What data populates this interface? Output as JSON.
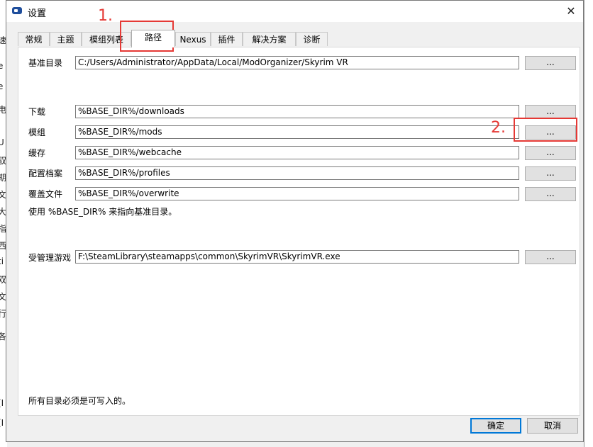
{
  "background": {
    "fragments": [
      "速",
      "e",
      "e",
      "电",
      "U",
      "驭",
      "期",
      "文",
      "大",
      "指",
      "西",
      "ti",
      "双",
      "文",
      "行",
      "各",
      "(I",
      "(I"
    ]
  },
  "window": {
    "title": "设置",
    "close_glyph": "✕"
  },
  "tabs": [
    {
      "label": "常规"
    },
    {
      "label": "主题"
    },
    {
      "label": "模组列表"
    },
    {
      "label": "路径",
      "active": true
    },
    {
      "label": "Nexus"
    },
    {
      "label": "插件"
    },
    {
      "label": "解决方案"
    },
    {
      "label": "诊断"
    }
  ],
  "paths": {
    "base": {
      "label": "基准目录",
      "value": "C:/Users/Administrator/AppData/Local/ModOrganizer/Skyrim VR",
      "button": "..."
    },
    "downloads": {
      "label": "下载",
      "value": "%BASE_DIR%/downloads",
      "button": "..."
    },
    "mods": {
      "label": "模组",
      "value": "%BASE_DIR%/mods",
      "button": "..."
    },
    "cache": {
      "label": "缓存",
      "value": "%BASE_DIR%/webcache",
      "button": "..."
    },
    "profiles": {
      "label": "配置档案",
      "value": "%BASE_DIR%/profiles",
      "button": "..."
    },
    "overwrite": {
      "label": "覆盖文件",
      "value": "%BASE_DIR%/overwrite",
      "button": "..."
    },
    "hint": "使用 %BASE_DIR% 来指向基准目录。",
    "managed_game": {
      "label": "受管理游戏",
      "value": "F:\\SteamLibrary\\steamapps\\common\\SkyrimVR\\SkyrimVR.exe",
      "button": "..."
    },
    "footer_note": "所有目录必须是可写入的。"
  },
  "buttons": {
    "ok": "确定",
    "cancel": "取消"
  },
  "annotations": {
    "step1": "1.",
    "step2": "2.",
    "color": "#e53935"
  }
}
